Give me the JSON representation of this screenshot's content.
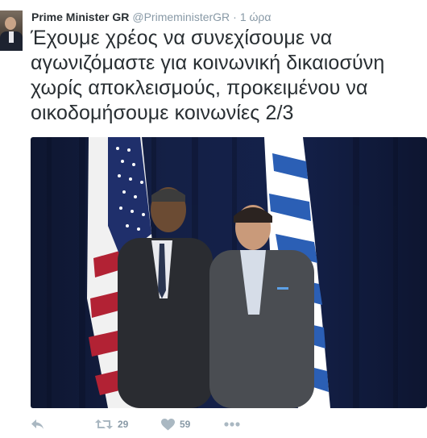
{
  "tweet": {
    "author_name": "Prime Minister GR",
    "handle": "@PrimeministerGR",
    "separator": "·",
    "time": "1 ώρα",
    "text": "Έχουμε χρέος να συνεχίσουμε να αγωνιζόμαστε για κοινωνική δικαιοσύνη χωρίς αποκλεισμούς, προκειμένου να οικοδομήσουμε κοινωνίες 2/3"
  },
  "actions": {
    "retweet_count": "29",
    "like_count": "59"
  },
  "icons": {
    "reply": "reply-icon",
    "retweet": "retweet-icon",
    "like": "heart-icon",
    "more": "more-icon"
  },
  "colors": {
    "icon_gray": "#aab8c2",
    "text": "#292f33",
    "meta": "#8899a6"
  }
}
